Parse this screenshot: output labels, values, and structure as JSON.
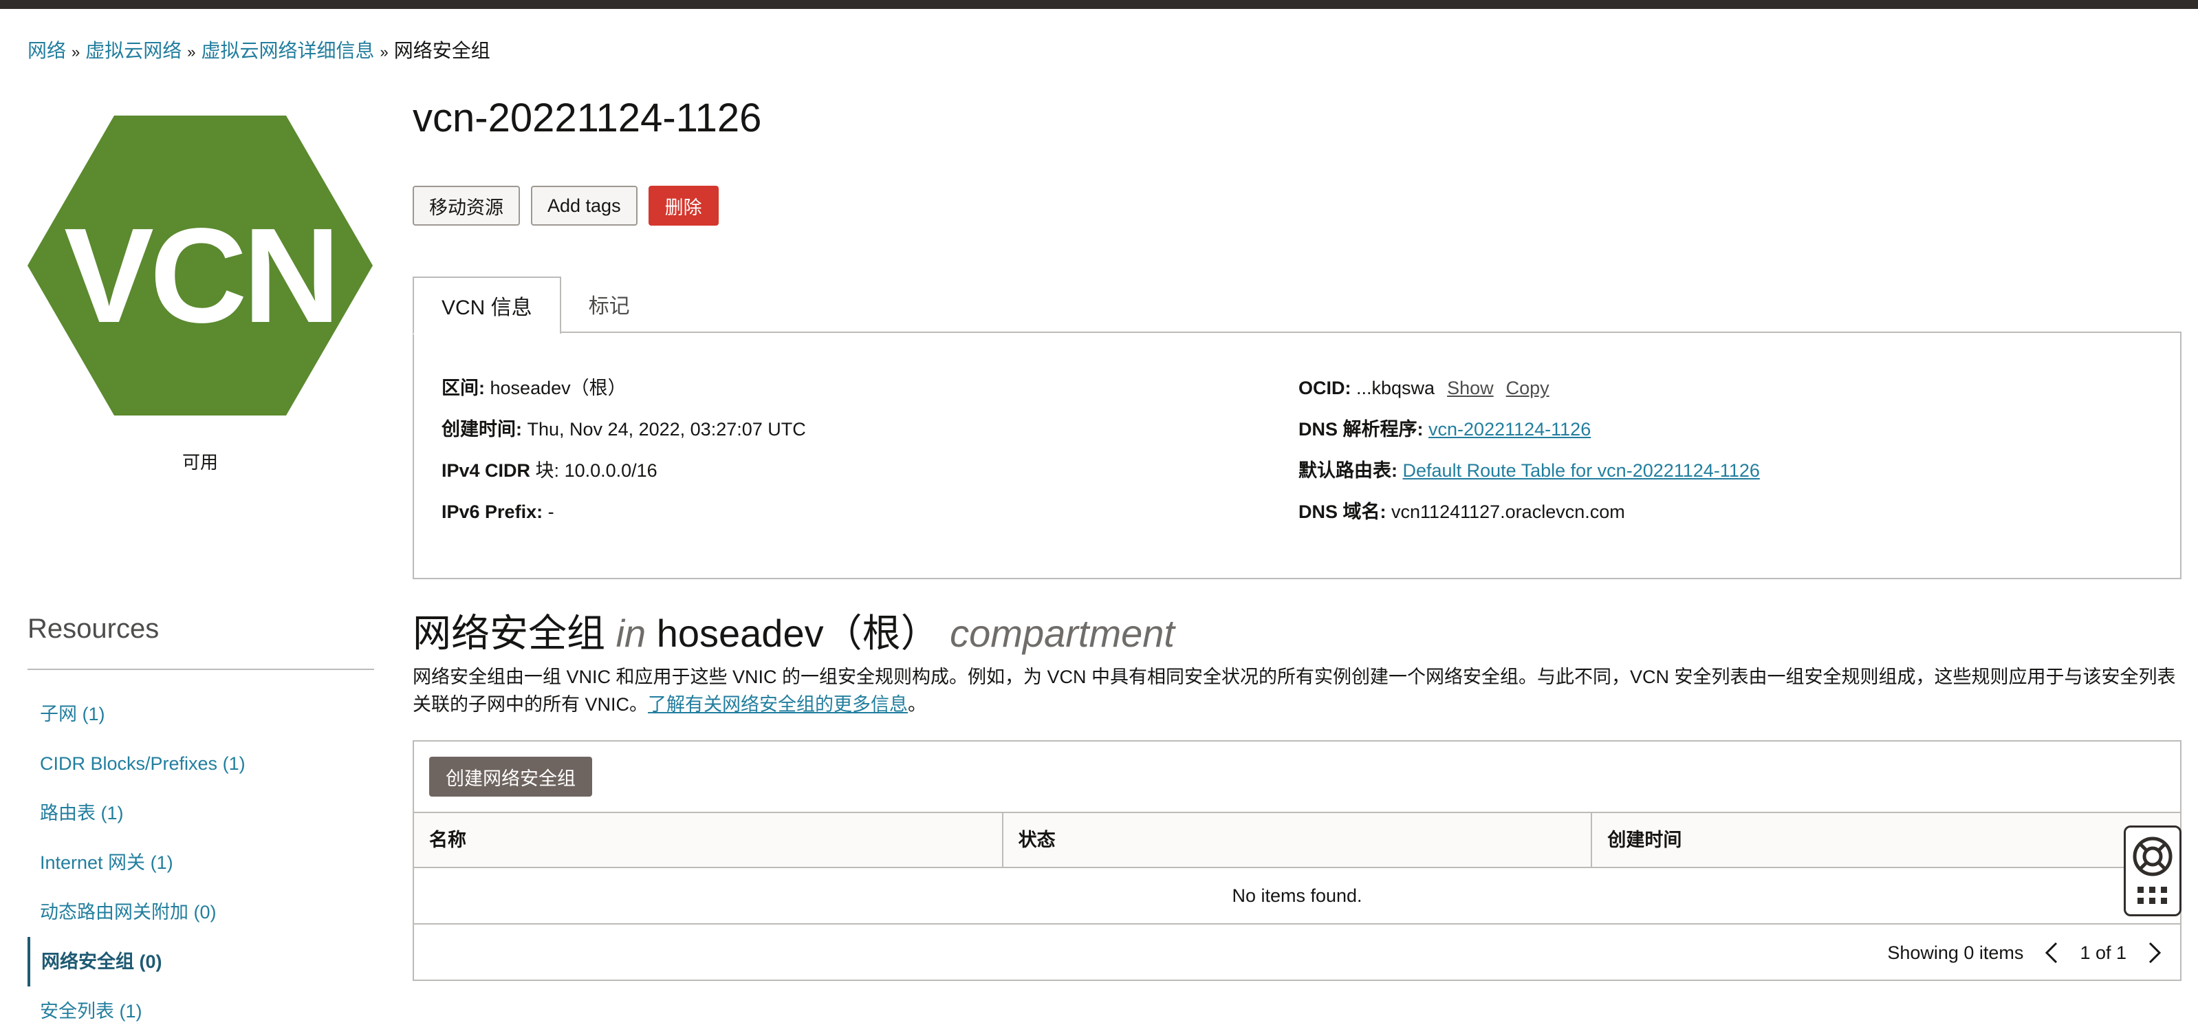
{
  "breadcrumb": {
    "items": [
      "网络",
      "虚拟云网络",
      "虚拟云网络详细信息"
    ],
    "current": "网络安全组",
    "separator": "»"
  },
  "vcn": {
    "logo_text": "VCN",
    "logo_color": "#5b8a2f",
    "state": "可用",
    "title": "vcn-20221124-1126"
  },
  "actions": {
    "move": "移动资源",
    "tags": "Add tags",
    "delete": "删除"
  },
  "tabs": {
    "info": "VCN 信息",
    "tags": "标记"
  },
  "info": {
    "compartment_label": "区间:",
    "compartment_value": "hoseadev（根）",
    "created_label": "创建时间:",
    "created_value": "Thu, Nov 24, 2022, 03:27:07 UTC",
    "ipv4_label": "IPv4 CIDR",
    "ipv4_label2": " 块:",
    "ipv4_value": "10.0.0.0/16",
    "ipv6_label": "IPv6 Prefix:",
    "ipv6_value": "-",
    "ocid_label": "OCID:",
    "ocid_value": "...kbqswa",
    "ocid_show": "Show",
    "ocid_copy": "Copy",
    "dns_resolver_label": "DNS",
    "dns_resolver_label2": " 解析程序:",
    "dns_resolver_value": "vcn-20221124-1126",
    "route_label": "默认路由表:",
    "route_value": "Default Route Table for vcn-20221124-1126",
    "dns_domain_label": "DNS",
    "dns_domain_label2": " 域名:",
    "dns_domain_value": "vcn11241127.oraclevcn.com"
  },
  "resources": {
    "title": "Resources",
    "items": [
      {
        "label": "子网",
        "count": "(1)"
      },
      {
        "label": "CIDR Blocks/Prefixes",
        "count": "(1)"
      },
      {
        "label": "路由表",
        "count": "(1)"
      },
      {
        "label": "Internet 网关",
        "count": "(1)"
      },
      {
        "label": "动态路由网关附加",
        "count": "(0)"
      },
      {
        "label": "网络安全组",
        "count": "(0)"
      },
      {
        "label": "安全列表",
        "count": "(1)"
      }
    ]
  },
  "section": {
    "title_main": "网络安全组",
    "title_in": "in",
    "title_comp": "hoseadev（根）",
    "title_suffix": "compartment",
    "desc": "网络安全组由一组 VNIC 和应用于这些 VNIC 的一组安全规则构成。例如，为 VCN 中具有相同安全状况的所有实例创建一个网络安全组。与此不同，VCN 安全列表由一组安全规则组成，这些规则应用于与该安全列表关联的子网中的所有 VNIC。",
    "learn_more": "了解有关网络安全组的更多信息",
    "desc_end": "。"
  },
  "table": {
    "create_button": "创建网络安全组",
    "columns": [
      "名称",
      "状态",
      "创建时间"
    ],
    "empty": "No items found.",
    "showing": "Showing 0 items",
    "page": "1 of 1"
  },
  "colors": {
    "link": "#227e9e",
    "danger": "#d4372d",
    "vcn_green": "#5b8a2f"
  }
}
